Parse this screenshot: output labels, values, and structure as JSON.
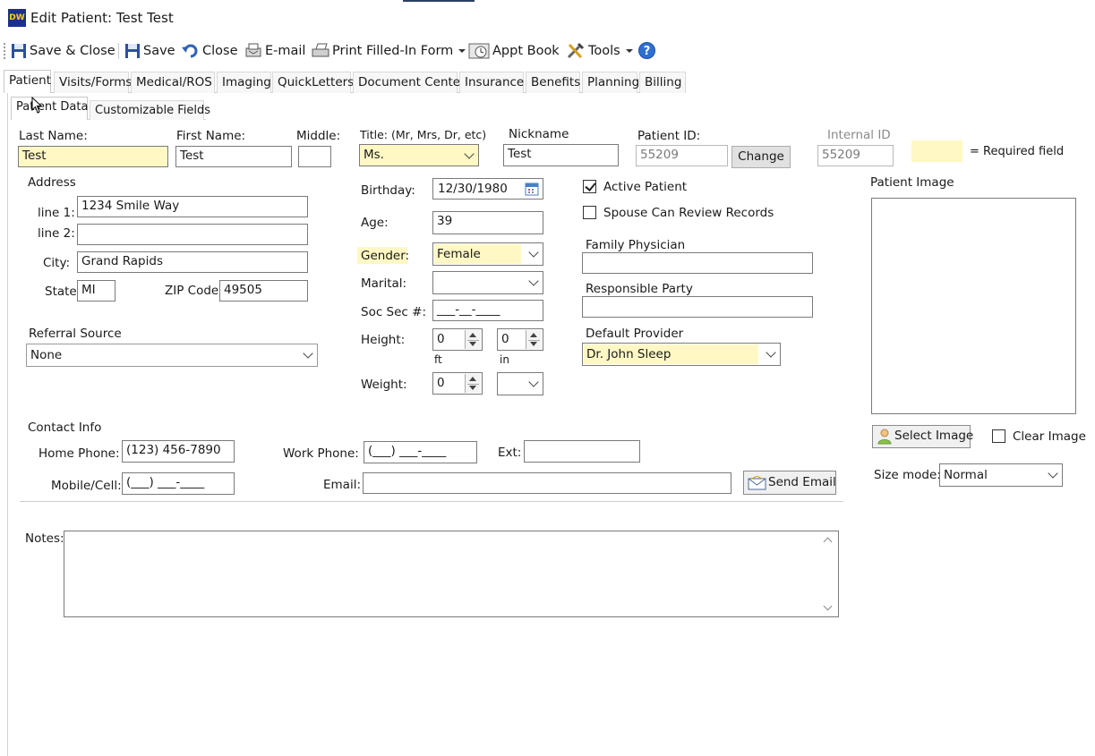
{
  "window": {
    "title": "Edit Patient: Test Test",
    "logo": "DW"
  },
  "toolbar": {
    "save_close": "Save & Close",
    "save": "Save",
    "close": "Close",
    "email": "E-mail",
    "print": "Print Filled-In Form",
    "appt_book": "Appt Book",
    "tools": "Tools"
  },
  "tabs": [
    "Patient",
    "Visits/Forms",
    "Medical/ROS",
    "Imaging",
    "QuickLetters",
    "Document Center",
    "Insurance",
    "Benefits",
    "Planning",
    "Billing"
  ],
  "subtabs": [
    "Patient Data",
    "Customizable Fields"
  ],
  "name": {
    "last_label": "Last Name:",
    "last_value": "Test",
    "first_label": "First Name:",
    "first_value": "Test",
    "middle_label": "Middle:",
    "middle_value": "",
    "title_label": "Title: (Mr, Mrs, Dr, etc)",
    "title_value": "Ms.",
    "nickname_label": "Nickname",
    "nickname_value": "Test",
    "patient_id_label": "Patient ID:",
    "patient_id_value": "55209",
    "change_label": "Change",
    "internal_id_label": "Internal ID",
    "internal_id_value": "55209",
    "required_legend": "= Required field"
  },
  "address": {
    "section_label": "Address",
    "line1_label": "line 1:",
    "line1_value": "1234 Smile Way",
    "line2_label": "line 2:",
    "line2_value": "",
    "city_label": "City:",
    "city_value": "Grand Rapids",
    "state_label": "State",
    "state_value": "MI",
    "zip_label": "ZIP Code",
    "zip_value": "49505"
  },
  "referral": {
    "label": "Referral Source",
    "value": "None"
  },
  "details": {
    "birthday_label": "Birthday:",
    "birthday_value": "12/30/1980",
    "age_label": "Age:",
    "age_value": "39",
    "gender_label": "Gender:",
    "gender_value": "Female",
    "marital_label": "Marital:",
    "marital_value": "",
    "ssn_label": "Soc Sec #:",
    "ssn_value": "___-__-____",
    "height_label": "Height:",
    "height_ft_value": "0",
    "height_in_value": "0",
    "ft_label": "ft",
    "in_label": "in",
    "weight_label": "Weight:",
    "weight_value": "0",
    "weight_unit_value": ""
  },
  "status": {
    "active_label": "Active Patient",
    "active_checked": true,
    "spouse_label": "Spouse Can Review Records",
    "spouse_checked": false,
    "family_physician_label": "Family Physician",
    "family_physician_value": "",
    "responsible_party_label": "Responsible Party",
    "responsible_party_value": "",
    "default_provider_label": "Default Provider",
    "default_provider_value": "Dr. John Sleep"
  },
  "image": {
    "label": "Patient Image",
    "select_label": "Select Image",
    "clear_label": "Clear Image",
    "size_mode_label": "Size mode:",
    "size_mode_value": "Normal"
  },
  "contact": {
    "section_label": "Contact Info",
    "home_label": "Home Phone:",
    "home_value": "(123) 456-7890",
    "work_label": "Work Phone:",
    "work_value": "(___) ___-____",
    "ext_label": "Ext:",
    "ext_value": "",
    "mobile_label": "Mobile/Cell:",
    "mobile_value": "(___) ___-____",
    "email_label": "Email:",
    "email_value": "",
    "send_email_label": "Send Email"
  },
  "notes": {
    "label": "Notes:",
    "value": ""
  },
  "colors": {
    "required": "#fff8c4",
    "accent": "#1a5fb4"
  }
}
